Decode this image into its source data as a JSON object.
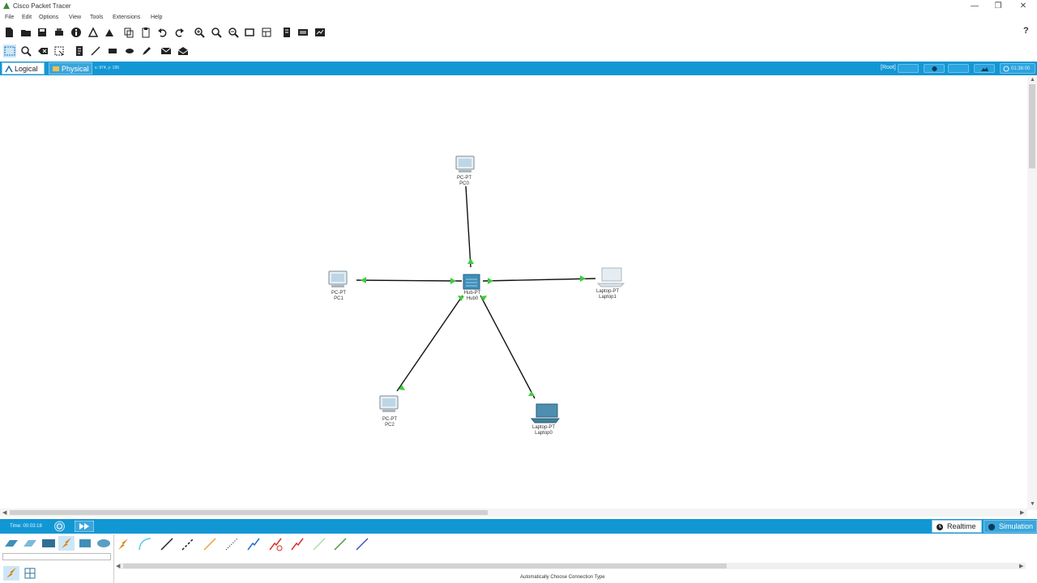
{
  "window": {
    "title": "Cisco Packet Tracer",
    "controls": [
      "—",
      "❐",
      "✕"
    ]
  },
  "menu": [
    "File",
    "Edit",
    "Options",
    "View",
    "Tools",
    "Extensions",
    "Help"
  ],
  "toolbar_help": "?",
  "tabs": {
    "logical": "Logical",
    "physical": "Physical",
    "coords": "x: 974, y: 195"
  },
  "topright": {
    "root": "[Root]",
    "clock": "01:38:00"
  },
  "devices": [
    {
      "id": "pc0",
      "type": "PC-PT",
      "name": "PC0"
    },
    {
      "id": "pc1",
      "type": "PC-PT",
      "name": "PC1"
    },
    {
      "id": "pc2",
      "type": "PC-PT",
      "name": "PC2"
    },
    {
      "id": "hub0",
      "type": "Hub-PT",
      "name": "Hub0"
    },
    {
      "id": "laptop0",
      "type": "Laptop-PT",
      "name": "Laptop0"
    },
    {
      "id": "laptop1",
      "type": "Laptop-PT",
      "name": "Laptop1"
    }
  ],
  "bottom": {
    "time": "Time: 00:03:18",
    "realtime": "Realtime",
    "simulation": "Simulation",
    "status": "Automatically Choose Connection Type"
  },
  "colors": {
    "accent": "#1197d4",
    "link_up": "#3dcc3d"
  }
}
